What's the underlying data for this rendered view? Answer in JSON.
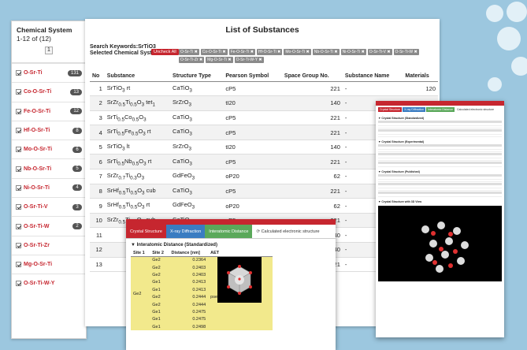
{
  "sidebar": {
    "title": "Chemical System",
    "range": "1-12  of  (12)",
    "page": "1",
    "items": [
      {
        "name": "O-Sr-Ti",
        "count": "131"
      },
      {
        "name": "Co-O-Sr-Ti",
        "count": "13"
      },
      {
        "name": "Fe-O-Sr-Ti",
        "count": "12"
      },
      {
        "name": "Hf-O-Sr-Ti",
        "count": "8"
      },
      {
        "name": "Mo-O-Sr-Ti",
        "count": "6"
      },
      {
        "name": "Nb-O-Sr-Ti",
        "count": "5"
      },
      {
        "name": "Ni-O-Sr-Ti",
        "count": "4"
      },
      {
        "name": "O-Sr-Ti-V",
        "count": "3"
      },
      {
        "name": "O-Sr-Ti-W",
        "count": "2"
      },
      {
        "name": "O-Sr-Ti-Zr",
        "count": ""
      },
      {
        "name": "Mg-O-Sr-Ti",
        "count": ""
      },
      {
        "name": "O-Sr-Ti-W-Y",
        "count": ""
      }
    ]
  },
  "main": {
    "title": "List of Substances",
    "search_keywords": "Search Keywords:SrTiO3",
    "selected_label": "Selected Chemical System:",
    "uncheck_all": "Uncheck All",
    "tags": [
      "O-Sr-Ti",
      "Co-O-Sr-Ti",
      "Fe-O-Sr-Ti",
      "Hf-O-Sr-Ti",
      "Mo-O-Sr-Ti",
      "Nb-O-Sr-Ti",
      "Ni-O-Sr-Ti",
      "O-Sr-Ti-V",
      "O-Sr-Ti-W",
      "O-Sr-Ti-Zr",
      "Mg-O-Sr-Ti",
      "O-Sr-Ti-W-Y"
    ],
    "columns": [
      "No",
      "Substance",
      "Structure Type",
      "Pearson Symbol",
      "Space Group No.",
      "Substance Name",
      "Materials"
    ],
    "rows": [
      {
        "no": "1",
        "substance": "SrTiO3 rt",
        "type": "CaTiO3",
        "pearson": "cP5",
        "sg": "221",
        "name": "-",
        "materials": "120"
      },
      {
        "no": "2",
        "substance": "SrZr0.5Ti0.5O3 tet1",
        "type": "SrZrO3",
        "pearson": "tI20",
        "sg": "140",
        "name": "-",
        "materials": "17"
      },
      {
        "no": "3",
        "substance": "SrTi0.5Co0.5O3",
        "type": "CaTiO3",
        "pearson": "cP5",
        "sg": "221",
        "name": "-",
        "materials": ""
      },
      {
        "no": "4",
        "substance": "SrTi0.5Fe0.5O3 rt",
        "type": "CaTiO3",
        "pearson": "cP5",
        "sg": "221",
        "name": "-",
        "materials": ""
      },
      {
        "no": "5",
        "substance": "SrTiO3 lt",
        "type": "SrZrO3",
        "pearson": "tI20",
        "sg": "140",
        "name": "-",
        "materials": ""
      },
      {
        "no": "6",
        "substance": "SrTi0.5Nb0.5O3 rt",
        "type": "CaTiO3",
        "pearson": "cP5",
        "sg": "221",
        "name": "-",
        "materials": ""
      },
      {
        "no": "7",
        "substance": "SrZr0.7Ti0.3O3",
        "type": "GdFeO3",
        "pearson": "oP20",
        "sg": "62",
        "name": "-",
        "materials": ""
      },
      {
        "no": "8",
        "substance": "SrHf0.5Ti0.5O3 cub",
        "type": "CaTiO3",
        "pearson": "cP5",
        "sg": "221",
        "name": "-",
        "materials": ""
      },
      {
        "no": "9",
        "substance": "SrHf0.5Ti0.5O3 rt",
        "type": "GdFeO3",
        "pearson": "oP20",
        "sg": "62",
        "name": "-",
        "materials": ""
      },
      {
        "no": "10",
        "substance": "SrZr0.5Ti0.5O3 cub",
        "type": "CaTiO3",
        "pearson": "cP5",
        "sg": "221",
        "name": "-",
        "materials": ""
      },
      {
        "no": "11",
        "substance": "",
        "type": "",
        "pearson": "",
        "sg": "140",
        "name": "-",
        "materials": ""
      },
      {
        "no": "12",
        "substance": "",
        "type": "",
        "pearson": "",
        "sg": "140",
        "name": "-",
        "materials": ""
      },
      {
        "no": "13",
        "substance": "",
        "type": "",
        "pearson": "",
        "sg": "221",
        "name": "-",
        "materials": ""
      }
    ]
  },
  "detail_small": {
    "tabs": [
      "Crystal Structure",
      "X-ray Diffraction",
      "Interatomic Distance",
      "Calculated electronic structure"
    ],
    "sections": [
      "Crystal Structure (Standardized)",
      "Crystal Structure (Experimental)",
      "Crystal Structure (Published)",
      "Crystal Structure with 3D View"
    ]
  },
  "detail_front": {
    "tabs": [
      "Crystal Structure",
      "X-ray Diffraction",
      "Interatomic Distance",
      "Calculated electronic structure"
    ],
    "heading": "Interatomic Distance (Standardized)",
    "columns": [
      "Site 1",
      "Site 2",
      "Distance [nm]",
      "AET"
    ],
    "site1": "Ge2",
    "aet": "pseudo Frank-Kasper (11)",
    "rows": [
      {
        "site2": "Ge2",
        "dist": "0.2364"
      },
      {
        "site2": "Ge2",
        "dist": "0.2403"
      },
      {
        "site2": "Ge2",
        "dist": "0.2403"
      },
      {
        "site2": "Ge1",
        "dist": "0.2413"
      },
      {
        "site2": "Ge1",
        "dist": "0.2413"
      },
      {
        "site2": "Ge2",
        "dist": "0.2444"
      },
      {
        "site2": "Ge2",
        "dist": "0.2444"
      },
      {
        "site2": "Ge1",
        "dist": "0.2475"
      },
      {
        "site2": "Ge1",
        "dist": "0.2475"
      },
      {
        "site2": "Ge1",
        "dist": "0.2498"
      }
    ]
  },
  "colors": {
    "accent": "#c6262f",
    "tab_blue": "#3a7cc1",
    "tab_green": "#5aa85a",
    "highlight": "#f2e98c"
  }
}
